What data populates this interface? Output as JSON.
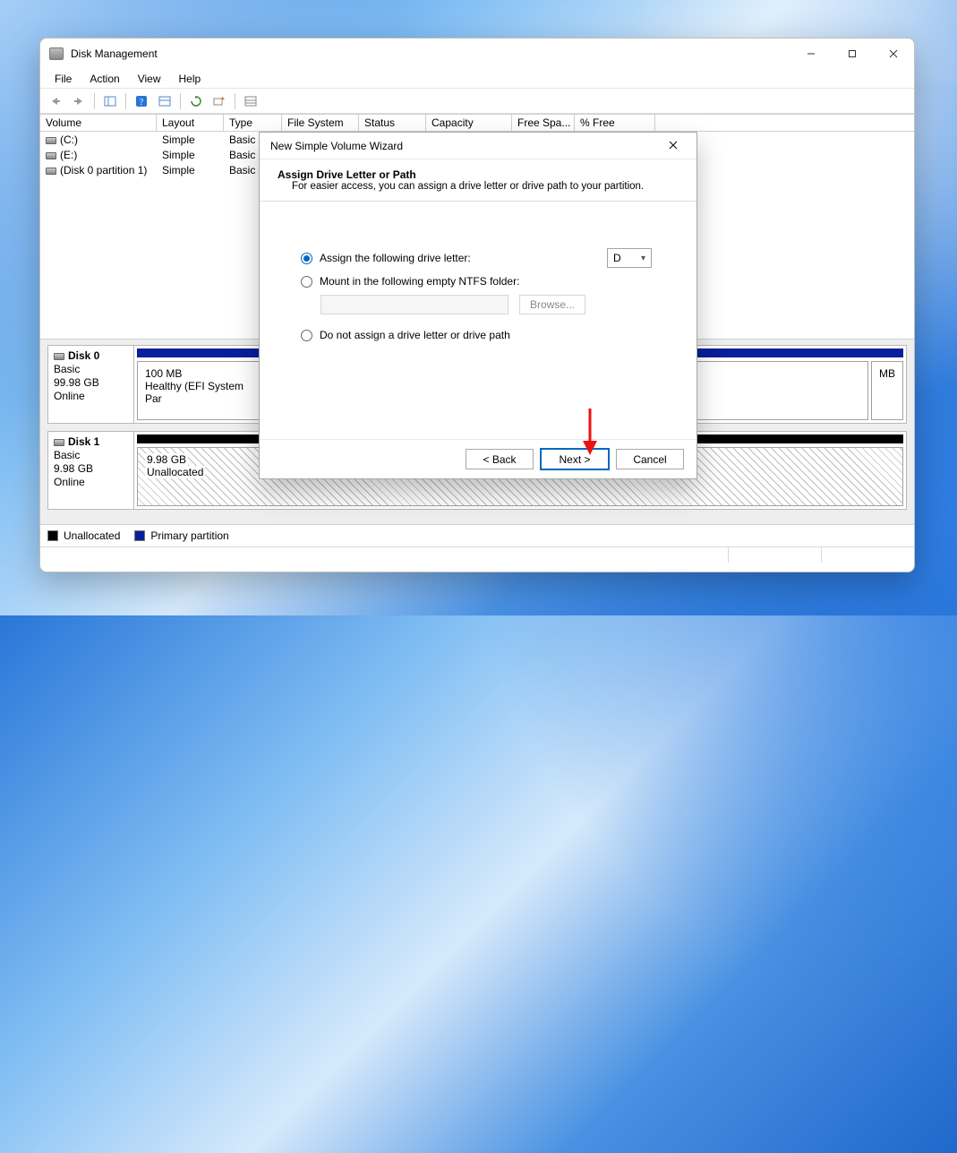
{
  "window": {
    "title": "Disk Management",
    "menu": {
      "file": "File",
      "action": "Action",
      "view": "View",
      "help": "Help"
    }
  },
  "columns": {
    "volume": "Volume",
    "layout": "Layout",
    "type": "Type",
    "fs": "File System",
    "status": "Status",
    "capacity": "Capacity",
    "free": "Free Spa...",
    "pct": "% Free"
  },
  "rows": [
    {
      "vol": "(C:)",
      "layout": "Simple",
      "type": "Basic"
    },
    {
      "vol": "(E:)",
      "layout": "Simple",
      "type": "Basic"
    },
    {
      "vol": "(Disk 0 partition 1)",
      "layout": "Simple",
      "type": "Basic"
    }
  ],
  "disks": [
    {
      "name": "Disk 0",
      "type": "Basic",
      "size": "99.98 GB",
      "state": "Online",
      "parts": [
        {
          "size": "100 MB",
          "desc": "Healthy (EFI System Par"
        },
        {
          "size": "",
          "desc": ""
        },
        {
          "size": "",
          "desc": "MB"
        }
      ]
    },
    {
      "name": "Disk 1",
      "type": "Basic",
      "size": "9.98 GB",
      "state": "Online",
      "parts": [
        {
          "size": "9.98 GB",
          "desc": "Unallocated"
        }
      ]
    }
  ],
  "legend": {
    "unallocated": "Unallocated",
    "primary": "Primary partition"
  },
  "wizard": {
    "title": "New Simple Volume Wizard",
    "heading": "Assign Drive Letter or Path",
    "subheading": "For easier access, you can assign a drive letter or drive path to your partition.",
    "optAssign": "Assign the following drive letter:",
    "driveLetter": "D",
    "optMount": "Mount in the following empty NTFS folder:",
    "browse": "Browse...",
    "optNone": "Do not assign a drive letter or drive path",
    "back": "< Back",
    "next": "Next >",
    "cancel": "Cancel"
  }
}
